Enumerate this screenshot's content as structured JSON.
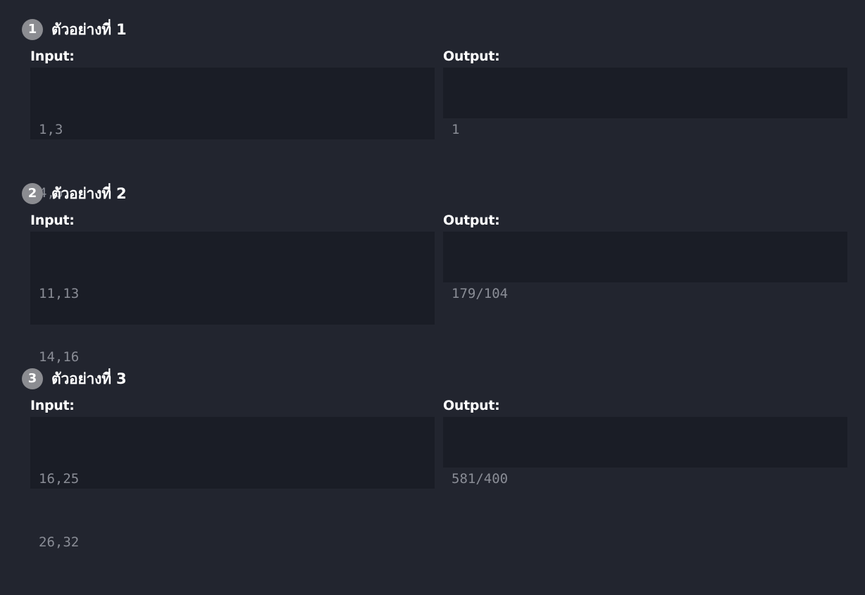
{
  "labels": {
    "input": "Input:",
    "output": "Output:"
  },
  "examples": [
    {
      "number": "1",
      "title": "ตัวอย่างที่ 1",
      "input_lines": [
        "1,3",
        "4,6"
      ],
      "output": "1"
    },
    {
      "number": "2",
      "title": "ตัวอย่างที่ 2",
      "input_lines": [
        "11,13",
        "14,16"
      ],
      "output": "179/104"
    },
    {
      "number": "3",
      "title": "ตัวอย่างที่ 3",
      "input_lines": [
        "16,25",
        "26,32"
      ],
      "output": "581/400"
    }
  ],
  "colors": {
    "background": "#22252f",
    "box": "#1a1d26",
    "badge": "#8b8c91",
    "code_text": "#8a8d96"
  }
}
